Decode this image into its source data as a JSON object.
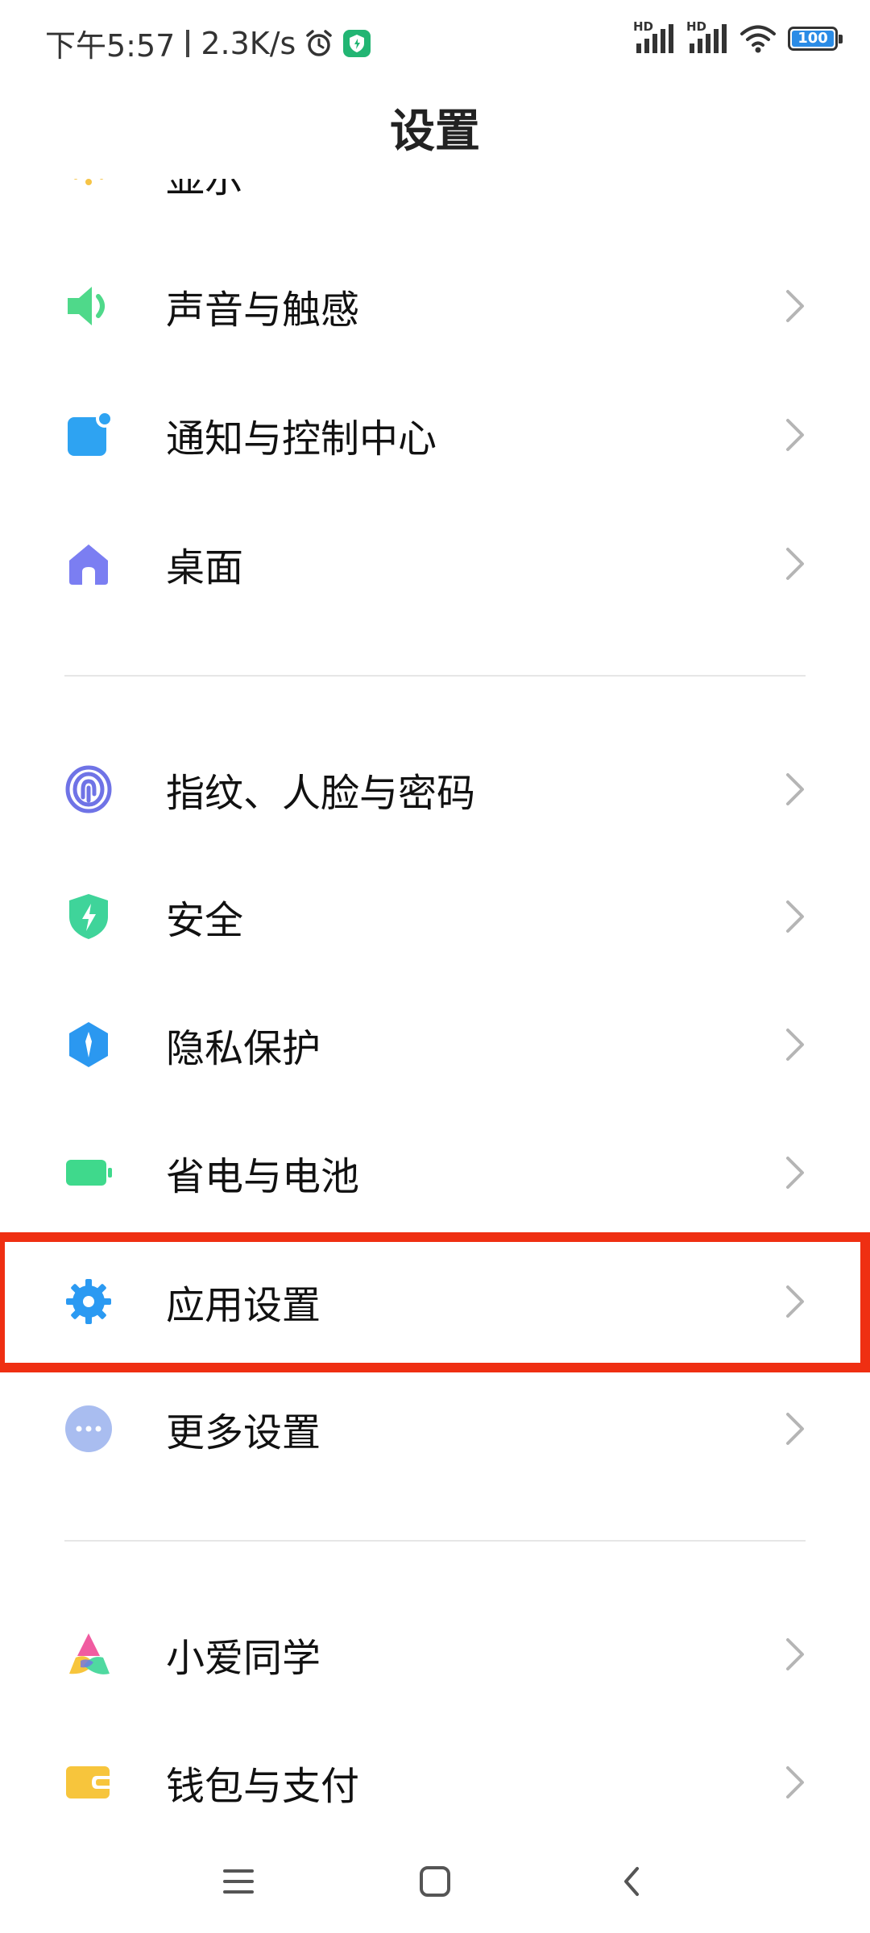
{
  "status_bar": {
    "time": "下午5:57",
    "net_speed": "2.3K/s",
    "network_1": "HD",
    "network_2": "HD",
    "battery": "100"
  },
  "header": {
    "title": "设置"
  },
  "menu": {
    "partial_top_item": {
      "label": "显示",
      "color": "#f6c446"
    },
    "items": [
      {
        "label": "声音与触感",
        "icon": "speaker-icon",
        "color": "#4fd98a"
      },
      {
        "label": "通知与控制中心",
        "icon": "notification-icon",
        "color": "#2ea3f2"
      },
      {
        "label": "桌面",
        "icon": "home-icon",
        "color": "#7b7ef2"
      },
      {
        "label": "指纹、人脸与密码",
        "icon": "fingerprint-icon",
        "color": "#6f73e6"
      },
      {
        "label": "安全",
        "icon": "shield-icon",
        "color": "#3fd49a"
      },
      {
        "label": "隐私保护",
        "icon": "privacy-icon",
        "color": "#2b98f0"
      },
      {
        "label": "省电与电池",
        "icon": "battery-icon",
        "color": "#3fd98c"
      },
      {
        "label": "应用设置",
        "icon": "gear-icon",
        "color": "#2b9af2"
      },
      {
        "label": "更多设置",
        "icon": "more-icon",
        "color": "#a9bdf0"
      },
      {
        "label": "小爱同学",
        "icon": "xiaoai-icon",
        "color": "#f05ba0"
      },
      {
        "label": "钱包与支付",
        "icon": "wallet-icon",
        "color": "#f7c53c"
      }
    ]
  },
  "highlight": {
    "item": "应用设置",
    "color": "#ef2f12"
  },
  "nav_bar": {
    "menu": "menu-icon",
    "home": "home-button-icon",
    "back": "back-icon"
  }
}
